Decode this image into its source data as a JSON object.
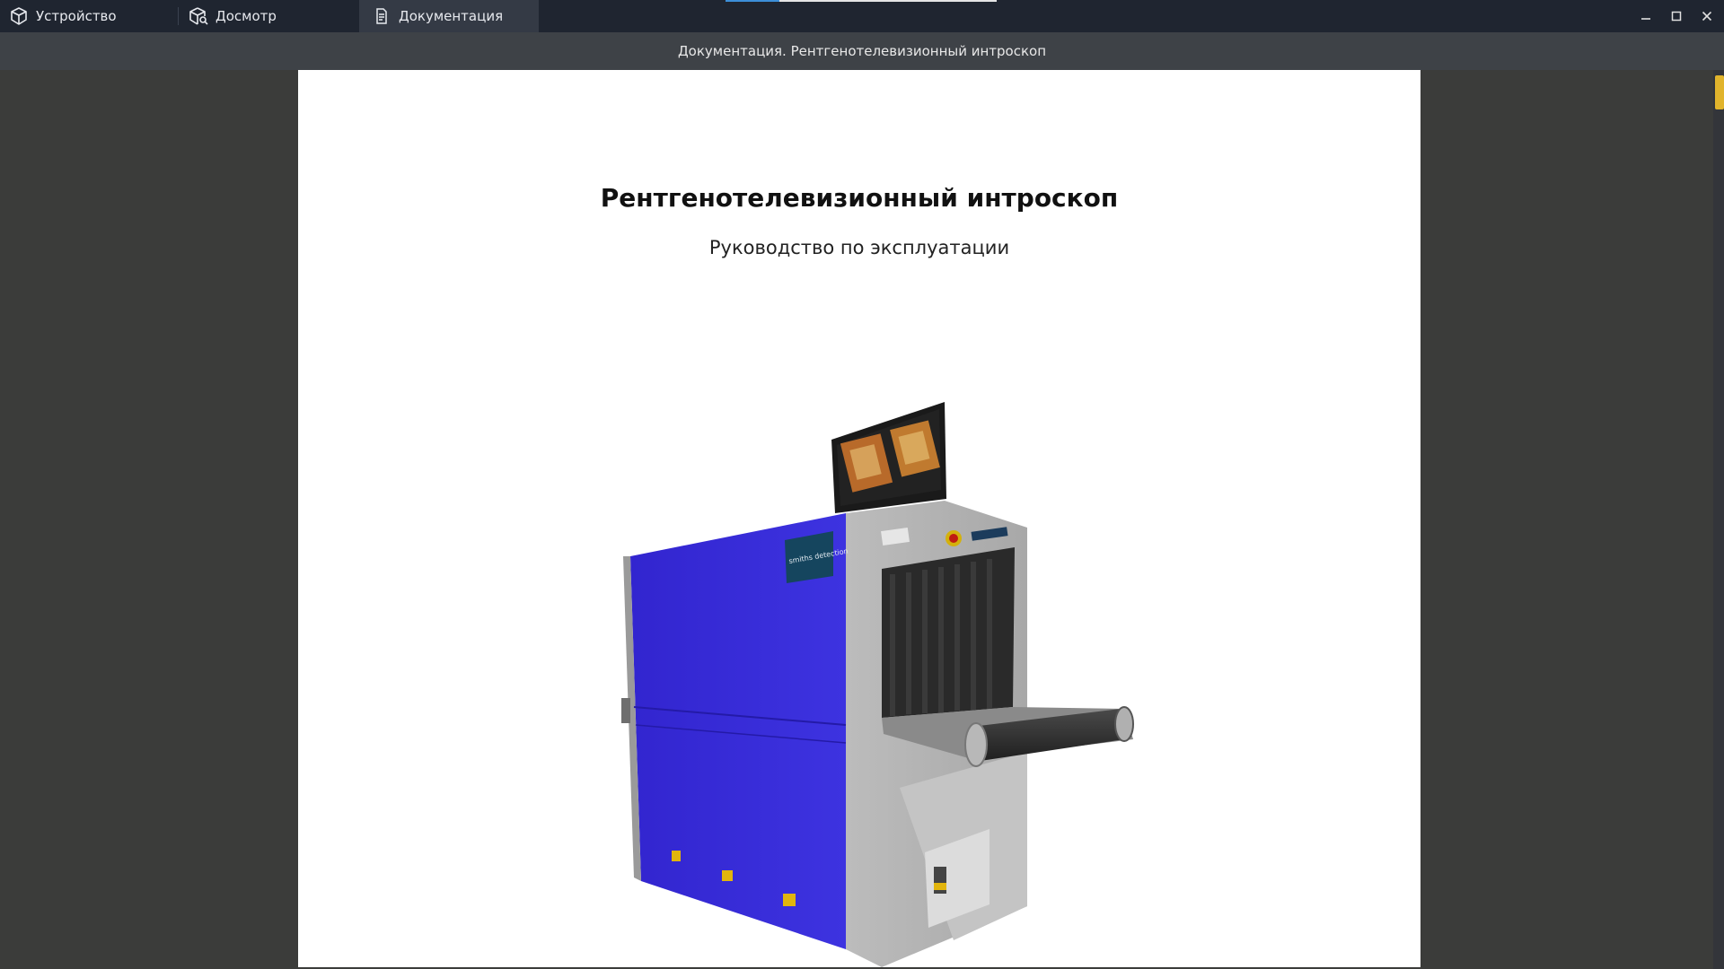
{
  "tabs": [
    {
      "label": "Устройство",
      "icon": "cube-icon"
    },
    {
      "label": "Досмотр",
      "icon": "cube-search-icon"
    },
    {
      "label": "Документация",
      "icon": "document-icon",
      "active": true
    }
  ],
  "window_title": "Документация. Рентгенотелевизионный интроскоп",
  "document": {
    "title": "Рентгенотелевизионный интроскоп",
    "subtitle": "Руководство по эксплуатации",
    "machine_brand": "smiths detection"
  },
  "colors": {
    "topbar": "#1f2530",
    "active_tab": "#343a45",
    "scroll_thumb": "#e1b42c",
    "machine_blue": "#3a2fd8"
  }
}
